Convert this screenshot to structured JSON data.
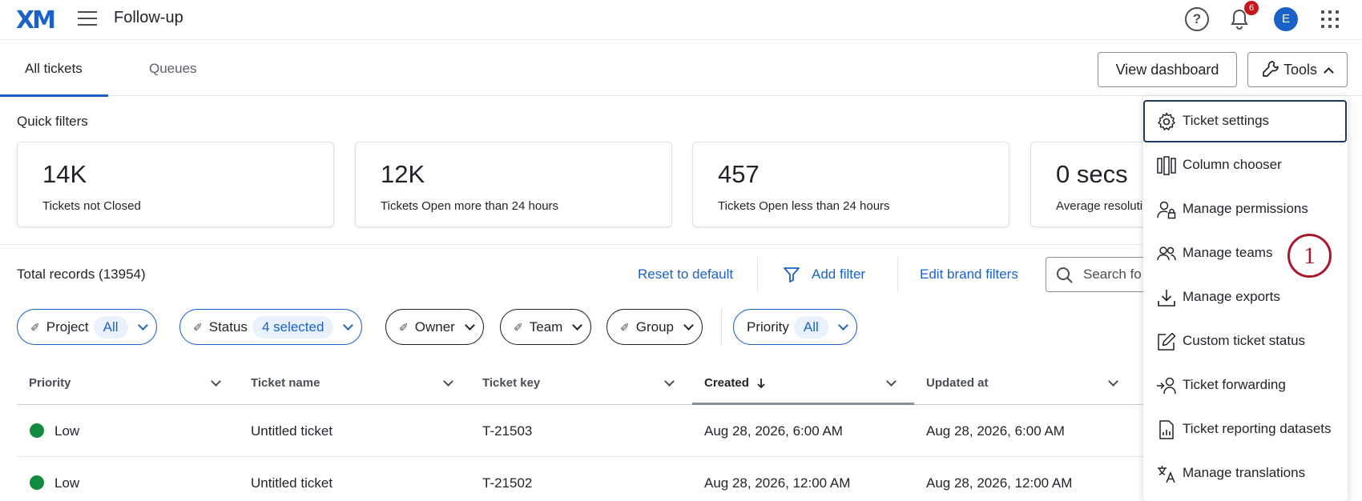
{
  "header": {
    "logo": "XM",
    "title": "Follow-up",
    "notification_count": "6",
    "avatar_initial": "E"
  },
  "tabs": [
    {
      "label": "All tickets",
      "active": true
    },
    {
      "label": "Queues",
      "active": false
    }
  ],
  "actions": {
    "view_dashboard": "View dashboard",
    "tools": "Tools"
  },
  "quick_filters": {
    "label": "Quick filters",
    "cards": [
      {
        "value": "14K",
        "label": "Tickets not Closed"
      },
      {
        "value": "12K",
        "label": "Tickets Open more than 24 hours"
      },
      {
        "value": "457",
        "label": "Tickets Open less than 24 hours"
      },
      {
        "value": "0 secs",
        "label": "Average resoluti"
      }
    ]
  },
  "toolbar": {
    "total": "Total records (13954)",
    "reset": "Reset to default",
    "add_filter": "Add filter",
    "edit_brand": "Edit brand filters",
    "search_placeholder": "Search fo"
  },
  "chips": [
    {
      "label": "Project",
      "value": "All"
    },
    {
      "label": "Status",
      "value": "4 selected"
    },
    {
      "label": "Owner",
      "value": ""
    },
    {
      "label": "Team",
      "value": ""
    },
    {
      "label": "Group",
      "value": ""
    },
    {
      "label": "Priority",
      "value": "All"
    }
  ],
  "table": {
    "columns": [
      "Priority",
      "Ticket name",
      "Ticket key",
      "Created",
      "Updated at"
    ],
    "rows": [
      {
        "priority": "Low",
        "name": "Untitled ticket",
        "key": "T-21503",
        "created": "Aug 28, 2026, 6:00 AM",
        "updated": "Aug 28, 2026, 6:00 AM"
      },
      {
        "priority": "Low",
        "name": "Untitled ticket",
        "key": "T-21502",
        "created": "Aug 28, 2026, 12:00 AM",
        "updated": "Aug 28, 2026, 12:00 AM"
      }
    ]
  },
  "tools_menu": {
    "items": [
      {
        "label": "Ticket settings",
        "icon": "gear-icon"
      },
      {
        "label": "Column chooser",
        "icon": "columns-icon"
      },
      {
        "label": "Manage permissions",
        "icon": "user-lock-icon"
      },
      {
        "label": "Manage teams",
        "icon": "users-icon"
      },
      {
        "label": "Manage exports",
        "icon": "download-icon"
      },
      {
        "label": "Custom ticket status",
        "icon": "edit-icon"
      },
      {
        "label": "Ticket forwarding",
        "icon": "forward-user-icon"
      },
      {
        "label": "Ticket reporting datasets",
        "icon": "report-icon"
      },
      {
        "label": "Manage translations",
        "icon": "translate-icon"
      }
    ]
  },
  "annotation": "1",
  "colors": {
    "accent": "#1a62c8",
    "priority_low": "#118a3e",
    "annotation": "#a8182a"
  }
}
